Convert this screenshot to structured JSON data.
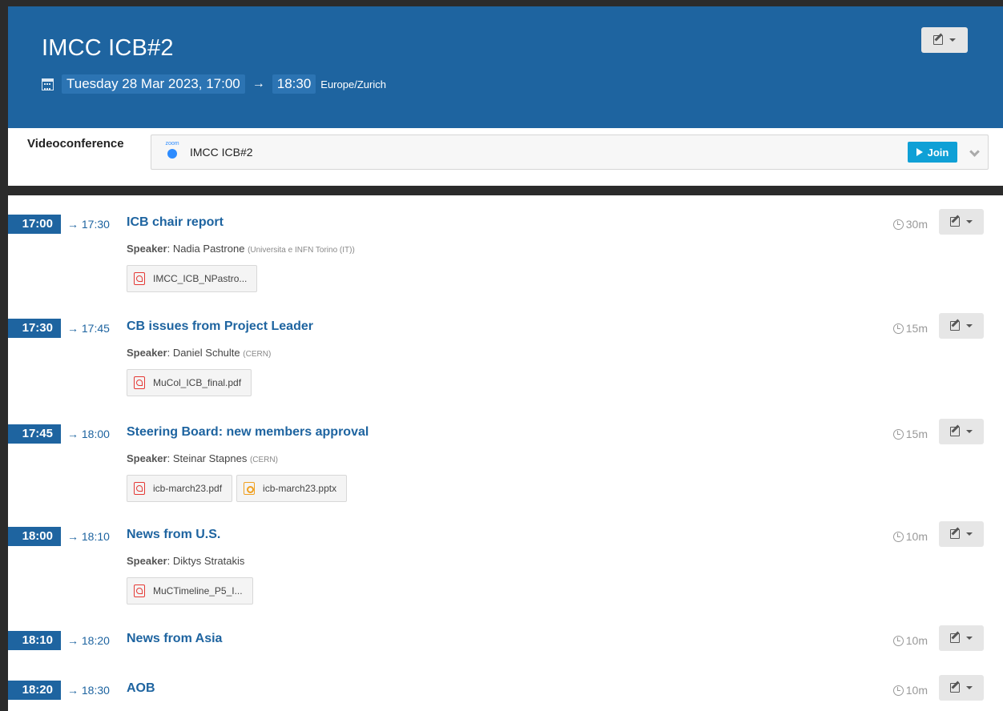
{
  "event": {
    "title": "IMCC ICB#2",
    "date_start": "Tuesday 28 Mar 2023, 17:00",
    "arrow": "→",
    "date_end": "18:30",
    "timezone": "Europe/Zurich"
  },
  "videoconference": {
    "label": "Videoconference",
    "zoom_word": "zoom",
    "room_name": "IMCC ICB#2",
    "join_label": "Join"
  },
  "entries": [
    {
      "start": "17:00",
      "end": "→ 17:30",
      "title": "ICB chair report",
      "speaker_label": "Speaker",
      "speaker": ": Nadia Pastrone",
      "affiliation": "(Universita e INFN Torino (IT))",
      "duration": "30m",
      "attachments": [
        {
          "name": "IMCC_ICB_NPastro...",
          "type": "pdf"
        }
      ]
    },
    {
      "start": "17:30",
      "end": "→ 17:45",
      "title": "CB issues from Project Leader",
      "speaker_label": "Speaker",
      "speaker": ": Daniel Schulte",
      "affiliation": "(CERN)",
      "duration": "15m",
      "attachments": [
        {
          "name": "MuCol_ICB_final.pdf",
          "type": "pdf"
        }
      ]
    },
    {
      "start": "17:45",
      "end": "→ 18:00",
      "title": "Steering Board: new members approval",
      "speaker_label": "Speaker",
      "speaker": ": Steinar Stapnes",
      "affiliation": "(CERN)",
      "duration": "15m",
      "attachments": [
        {
          "name": "icb-march23.pdf",
          "type": "pdf"
        },
        {
          "name": "icb-march23.pptx",
          "type": "pptx"
        }
      ]
    },
    {
      "start": "18:00",
      "end": "→ 18:10",
      "title": "News from U.S.",
      "speaker_label": "Speaker",
      "speaker": ": Diktys Stratakis",
      "affiliation": "",
      "duration": "10m",
      "attachments": [
        {
          "name": "MuCTimeline_P5_I...",
          "type": "pdf"
        }
      ]
    },
    {
      "start": "18:10",
      "end": "→ 18:20",
      "title": "News from Asia",
      "duration": "10m"
    },
    {
      "start": "18:20",
      "end": "→ 18:30",
      "title": "AOB",
      "duration": "10m"
    }
  ]
}
